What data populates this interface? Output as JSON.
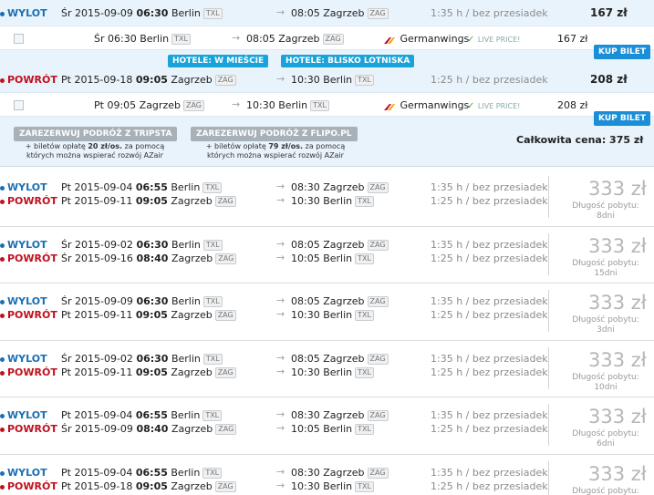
{
  "selected": {
    "outbound": {
      "label": "WYLOT",
      "date": "Śr 2015-09-09",
      "time": "06:30",
      "from": "Berlin",
      "from_code": "TXL",
      "arr_time": "08:05",
      "to": "Zagrzeb",
      "to_code": "ZAG",
      "duration": "1:35 h / bez przesiadek",
      "price": "167 zł"
    },
    "outbound_detail": {
      "time": "Śr 06:30",
      "from": "Berlin",
      "from_code": "TXL",
      "arr_time": "08:05",
      "to": "Zagrzeb",
      "to_code": "ZAG",
      "airline": "Germanwings",
      "live": "LIVE PRICE!",
      "price": "167 zł",
      "buy": "KUP BILET"
    },
    "hotel_buttons": [
      "HOTELE: W MIEŚCIE",
      "HOTELE: BLISKO LOTNISKA"
    ],
    "inbound": {
      "label": "POWRÓT",
      "date": "Pt 2015-09-18",
      "time": "09:05",
      "from": "Zagrzeb",
      "from_code": "ZAG",
      "arr_time": "10:30",
      "to": "Berlin",
      "to_code": "TXL",
      "duration": "1:25 h / bez przesiadek",
      "price": "208 zł"
    },
    "inbound_detail": {
      "time": "Pt 09:05",
      "from": "Zagrzeb",
      "from_code": "ZAG",
      "arr_time": "10:30",
      "to": "Berlin",
      "to_code": "TXL",
      "airline": "Germanwings",
      "live": "LIVE PRICE!",
      "price": "208 zł",
      "buy": "KUP BILET"
    },
    "booking": [
      {
        "button": "ZAREZERWUJ PODRÓŻ Z TRIPSTA",
        "note_a": "+ biletów opłatę ",
        "fee": "20 zł/os.",
        "note_b": " za pomocą",
        "note_c": "których można wspierać rozwój AZair"
      },
      {
        "button": "ZAREZERWUJ PODRÓŻ Z FLIPO.PL",
        "note_a": "+ biletów opłatę ",
        "fee": "79 zł/os.",
        "note_b": " za pomocą",
        "note_c": "których można wspierać rozwój AZair"
      }
    ],
    "total": "Całkowita cena: 375 zł"
  },
  "stay_label": "Długość pobytu:",
  "results": [
    {
      "out": {
        "label": "WYLOT",
        "date": "Pt 2015-09-04",
        "time": "06:55",
        "from": "Berlin",
        "from_code": "TXL",
        "arr_time": "08:30",
        "to": "Zagrzeb",
        "to_code": "ZAG",
        "duration": "1:35 h / bez przesiadek"
      },
      "ret": {
        "label": "POWRÓT",
        "date": "Pt 2015-09-11",
        "time": "09:05",
        "from": "Zagrzeb",
        "from_code": "ZAG",
        "arr_time": "10:30",
        "to": "Berlin",
        "to_code": "TXL",
        "duration": "1:25 h / bez przesiadek"
      },
      "price": "333 zł",
      "stay": "8dni"
    },
    {
      "out": {
        "label": "WYLOT",
        "date": "Śr 2015-09-02",
        "time": "06:30",
        "from": "Berlin",
        "from_code": "TXL",
        "arr_time": "08:05",
        "to": "Zagrzeb",
        "to_code": "ZAG",
        "duration": "1:35 h / bez przesiadek"
      },
      "ret": {
        "label": "POWRÓT",
        "date": "Śr 2015-09-16",
        "time": "08:40",
        "from": "Zagrzeb",
        "from_code": "ZAG",
        "arr_time": "10:05",
        "to": "Berlin",
        "to_code": "TXL",
        "duration": "1:25 h / bez przesiadek"
      },
      "price": "333 zł",
      "stay": "15dni"
    },
    {
      "out": {
        "label": "WYLOT",
        "date": "Śr 2015-09-09",
        "time": "06:30",
        "from": "Berlin",
        "from_code": "TXL",
        "arr_time": "08:05",
        "to": "Zagrzeb",
        "to_code": "ZAG",
        "duration": "1:35 h / bez przesiadek"
      },
      "ret": {
        "label": "POWRÓT",
        "date": "Pt 2015-09-11",
        "time": "09:05",
        "from": "Zagrzeb",
        "from_code": "ZAG",
        "arr_time": "10:30",
        "to": "Berlin",
        "to_code": "TXL",
        "duration": "1:25 h / bez przesiadek"
      },
      "price": "333 zł",
      "stay": "3dni"
    },
    {
      "out": {
        "label": "WYLOT",
        "date": "Śr 2015-09-02",
        "time": "06:30",
        "from": "Berlin",
        "from_code": "TXL",
        "arr_time": "08:05",
        "to": "Zagrzeb",
        "to_code": "ZAG",
        "duration": "1:35 h / bez przesiadek"
      },
      "ret": {
        "label": "POWRÓT",
        "date": "Pt 2015-09-11",
        "time": "09:05",
        "from": "Zagrzeb",
        "from_code": "ZAG",
        "arr_time": "10:30",
        "to": "Berlin",
        "to_code": "TXL",
        "duration": "1:25 h / bez przesiadek"
      },
      "price": "333 zł",
      "stay": "10dni"
    },
    {
      "out": {
        "label": "WYLOT",
        "date": "Pt 2015-09-04",
        "time": "06:55",
        "from": "Berlin",
        "from_code": "TXL",
        "arr_time": "08:30",
        "to": "Zagrzeb",
        "to_code": "ZAG",
        "duration": "1:35 h / bez przesiadek"
      },
      "ret": {
        "label": "POWRÓT",
        "date": "Śr 2015-09-09",
        "time": "08:40",
        "from": "Zagrzeb",
        "from_code": "ZAG",
        "arr_time": "10:05",
        "to": "Berlin",
        "to_code": "TXL",
        "duration": "1:25 h / bez przesiadek"
      },
      "price": "333 zł",
      "stay": "6dni"
    },
    {
      "out": {
        "label": "WYLOT",
        "date": "Pt 2015-09-04",
        "time": "06:55",
        "from": "Berlin",
        "from_code": "TXL",
        "arr_time": "08:30",
        "to": "Zagrzeb",
        "to_code": "ZAG",
        "duration": "1:35 h / bez przesiadek"
      },
      "ret": {
        "label": "POWRÓT",
        "date": "Pt 2015-09-18",
        "time": "09:05",
        "from": "Zagrzeb",
        "from_code": "ZAG",
        "arr_time": "10:30",
        "to": "Berlin",
        "to_code": "TXL",
        "duration": "1:25 h / bez przesiadek"
      },
      "price": "333 zł",
      "stay": ""
    }
  ]
}
